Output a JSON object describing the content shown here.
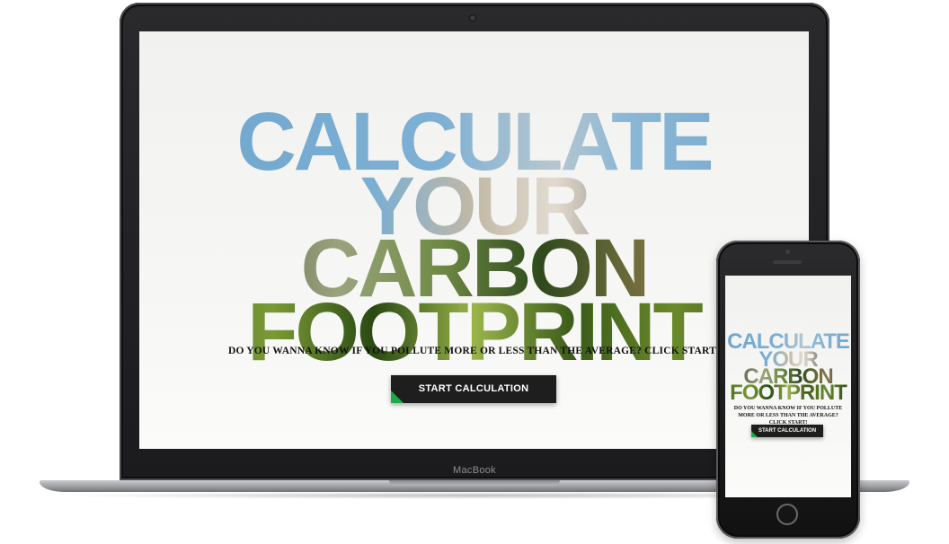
{
  "laptop": {
    "brand_label": "MacBook",
    "title_lines": [
      "CALCULATE",
      "YOUR",
      "CARBON",
      "FOOTPRINT"
    ],
    "question": "DO YOU WANNA KNOW IF YOU POLLUTE MORE OR LESS THAN THE AVERAGE? CLICK START!",
    "start_button_label": "START CALCULATION"
  },
  "phone": {
    "title_lines": [
      "CALCULATE",
      "YOUR",
      "CARBON",
      "FOOTPRINT"
    ],
    "question": "DO YOU WANNA KNOW IF YOU POLLUTE MORE OR LESS THAN THE AVERAGE? CLICK START!",
    "start_button_label": "START CALCULATION"
  },
  "colors": {
    "button_background": "#1e1e1e",
    "button_accent": "#1fa84a",
    "sky_blue": "#7aaed3",
    "forest_green": "#4a6a22"
  }
}
